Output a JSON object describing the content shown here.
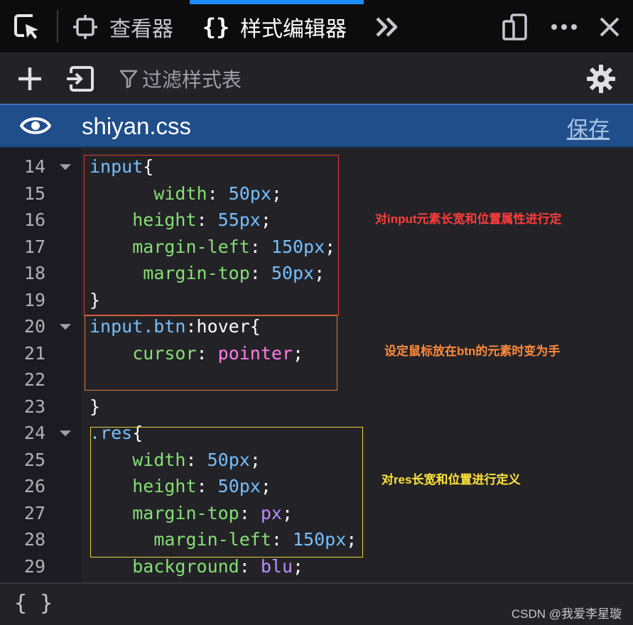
{
  "tabs": {
    "inspector_label": "查看器",
    "style_editor_label": "样式编辑器"
  },
  "toolbar": {
    "filter_placeholder": "过滤样式表"
  },
  "stylesheet": {
    "name": "shiyan.css",
    "save_label": "保存"
  },
  "editor": {
    "lines": [
      {
        "n": "14",
        "fold": true,
        "tokens": [
          {
            "t": "input",
            "c": "sel"
          },
          {
            "t": "{",
            "c": "punc"
          }
        ]
      },
      {
        "n": "15",
        "fold": false,
        "tokens": [
          {
            "t": "      ",
            "c": "punc"
          },
          {
            "t": "width",
            "c": "prop"
          },
          {
            "t": ": ",
            "c": "punc"
          },
          {
            "t": "50px",
            "c": "num"
          },
          {
            "t": ";",
            "c": "punc"
          }
        ]
      },
      {
        "n": "16",
        "fold": false,
        "tokens": [
          {
            "t": "    ",
            "c": "punc"
          },
          {
            "t": "height",
            "c": "prop"
          },
          {
            "t": ": ",
            "c": "punc"
          },
          {
            "t": "55px",
            "c": "num"
          },
          {
            "t": ";",
            "c": "punc"
          }
        ]
      },
      {
        "n": "17",
        "fold": false,
        "tokens": [
          {
            "t": "    ",
            "c": "punc"
          },
          {
            "t": "margin-left",
            "c": "prop"
          },
          {
            "t": ": ",
            "c": "punc"
          },
          {
            "t": "150px",
            "c": "num"
          },
          {
            "t": ";",
            "c": "punc"
          }
        ]
      },
      {
        "n": "18",
        "fold": false,
        "tokens": [
          {
            "t": "     ",
            "c": "punc"
          },
          {
            "t": "margin-top",
            "c": "prop"
          },
          {
            "t": ": ",
            "c": "punc"
          },
          {
            "t": "50px",
            "c": "num"
          },
          {
            "t": ";",
            "c": "punc"
          }
        ]
      },
      {
        "n": "19",
        "fold": false,
        "tokens": [
          {
            "t": "}",
            "c": "punc"
          }
        ]
      },
      {
        "n": "20",
        "fold": true,
        "tokens": [
          {
            "t": "input.btn",
            "c": "sel"
          },
          {
            "t": ":hover{",
            "c": "punc"
          }
        ]
      },
      {
        "n": "21",
        "fold": false,
        "tokens": [
          {
            "t": "    ",
            "c": "punc"
          },
          {
            "t": "cursor",
            "c": "prop"
          },
          {
            "t": ": ",
            "c": "punc"
          },
          {
            "t": "pointer",
            "c": "kw"
          },
          {
            "t": ";",
            "c": "punc"
          }
        ]
      },
      {
        "n": "22",
        "fold": false,
        "tokens": []
      },
      {
        "n": "23",
        "fold": false,
        "tokens": [
          {
            "t": "}",
            "c": "punc"
          }
        ]
      },
      {
        "n": "24",
        "fold": true,
        "tokens": [
          {
            "t": ".res",
            "c": "sel"
          },
          {
            "t": "{",
            "c": "punc"
          }
        ]
      },
      {
        "n": "25",
        "fold": false,
        "tokens": [
          {
            "t": "    ",
            "c": "punc"
          },
          {
            "t": "width",
            "c": "prop"
          },
          {
            "t": ": ",
            "c": "punc"
          },
          {
            "t": "50px",
            "c": "num"
          },
          {
            "t": ";",
            "c": "punc"
          }
        ]
      },
      {
        "n": "26",
        "fold": false,
        "tokens": [
          {
            "t": "    ",
            "c": "punc"
          },
          {
            "t": "height",
            "c": "prop"
          },
          {
            "t": ": ",
            "c": "punc"
          },
          {
            "t": "50px",
            "c": "num"
          },
          {
            "t": ";",
            "c": "punc"
          }
        ]
      },
      {
        "n": "27",
        "fold": false,
        "tokens": [
          {
            "t": "    ",
            "c": "punc"
          },
          {
            "t": "margin-top",
            "c": "prop"
          },
          {
            "t": ": ",
            "c": "punc"
          },
          {
            "t": "px",
            "c": "val"
          },
          {
            "t": ";",
            "c": "punc"
          }
        ]
      },
      {
        "n": "28",
        "fold": false,
        "tokens": [
          {
            "t": "      ",
            "c": "punc"
          },
          {
            "t": "margin-left",
            "c": "prop"
          },
          {
            "t": ": ",
            "c": "punc"
          },
          {
            "t": "150px",
            "c": "num"
          },
          {
            "t": ";",
            "c": "punc"
          }
        ]
      },
      {
        "n": "29",
        "fold": false,
        "tokens": [
          {
            "t": "    ",
            "c": "punc"
          },
          {
            "t": "background",
            "c": "prop"
          },
          {
            "t": ": ",
            "c": "punc"
          },
          {
            "t": "blu",
            "c": "val"
          },
          {
            "t": ";",
            "c": "punc"
          }
        ]
      }
    ]
  },
  "annotations": {
    "note1": "对input元素长宽和位置属性进行定",
    "note2": "设定鼠标放在btn的元素时变为手",
    "note3": "对res长宽和位置进行定义"
  },
  "footer": {
    "pretty_print_label": "{ }",
    "watermark": "CSDN @我爱李星璇"
  }
}
